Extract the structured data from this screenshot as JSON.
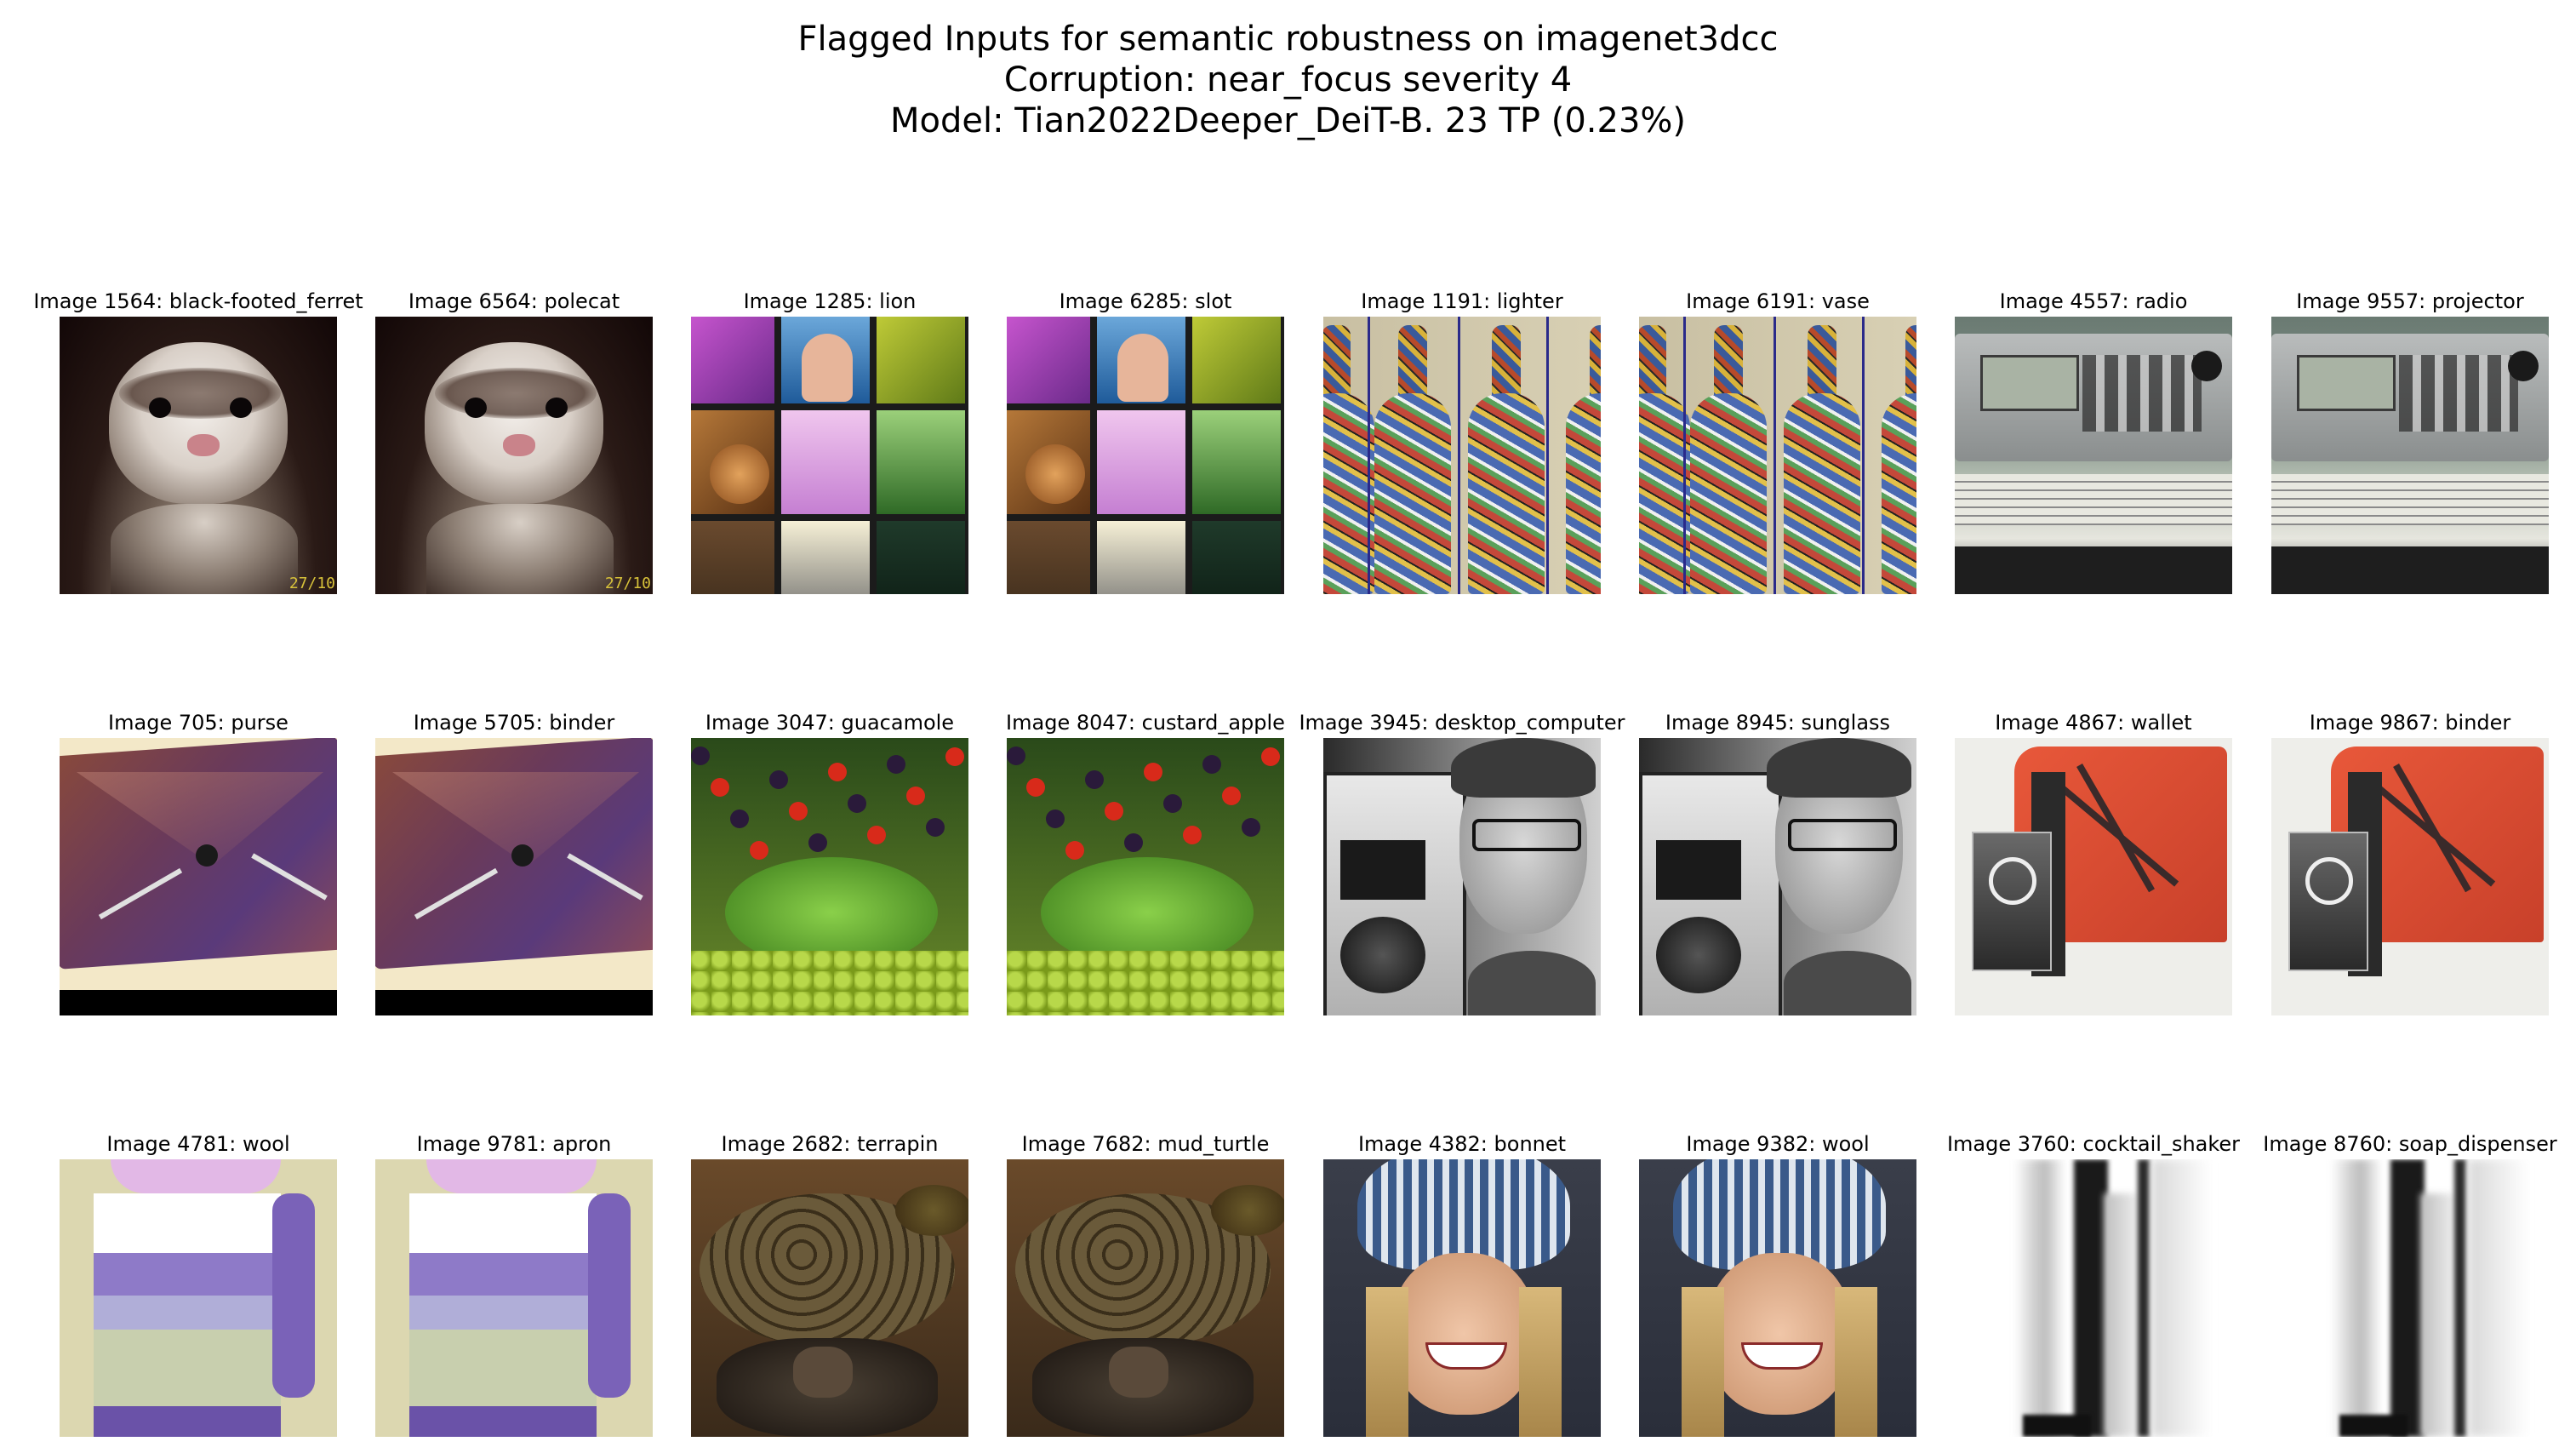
{
  "figure": {
    "title_lines": [
      "Flagged Inputs for semantic robustness on imagenet3dcc",
      "Corruption: near_focus severity 4",
      "Model: Tian2022Deeper_DeiT-B. 23 TP (0.23%)"
    ]
  },
  "thumbnails": [
    {
      "caption": "Image 1564: black-footed_ferret",
      "icon": "ferret-photo"
    },
    {
      "caption": "Image 6564: polecat",
      "icon": "ferret-photo"
    },
    {
      "caption": "Image 1285: lion",
      "icon": "photo-collage"
    },
    {
      "caption": "Image 6285: slot",
      "icon": "photo-collage"
    },
    {
      "caption": "Image 1191: lighter",
      "icon": "mosaic-bottles-photo"
    },
    {
      "caption": "Image 6191: vase",
      "icon": "mosaic-bottles-photo"
    },
    {
      "caption": "Image 4557: radio",
      "icon": "radio-scanner-photo"
    },
    {
      "caption": "Image 9557: projector",
      "icon": "radio-scanner-photo"
    },
    {
      "caption": "Image 705: purse",
      "icon": "leather-purse-photo"
    },
    {
      "caption": "Image 5705: binder",
      "icon": "leather-purse-photo"
    },
    {
      "caption": "Image 3047: guacamole",
      "icon": "fruit-carving-photo"
    },
    {
      "caption": "Image 8047: custard_apple",
      "icon": "fruit-carving-photo"
    },
    {
      "caption": "Image 3945: desktop_computer",
      "icon": "man-with-boombox-photo"
    },
    {
      "caption": "Image 8945: sunglass",
      "icon": "man-with-boombox-photo"
    },
    {
      "caption": "Image 4867: wallet",
      "icon": "orange-wallet-photo"
    },
    {
      "caption": "Image 9867: binder",
      "icon": "orange-wallet-photo"
    },
    {
      "caption": "Image 4781: wool",
      "icon": "striped-sweater-photo"
    },
    {
      "caption": "Image 9781: apron",
      "icon": "striped-sweater-photo"
    },
    {
      "caption": "Image 2682: terrapin",
      "icon": "turtle-photo"
    },
    {
      "caption": "Image 7682: mud_turtle",
      "icon": "turtle-photo"
    },
    {
      "caption": "Image 4382: bonnet",
      "icon": "woman-in-knit-hat-photo"
    },
    {
      "caption": "Image 9382: wool",
      "icon": "woman-in-knit-hat-photo"
    },
    {
      "caption": "Image 3760: cocktail_shaker",
      "icon": "blurred-metal-closeup-photo"
    },
    {
      "caption": "Image 8760: soap_dispenser",
      "icon": "blurred-metal-closeup-photo"
    }
  ]
}
